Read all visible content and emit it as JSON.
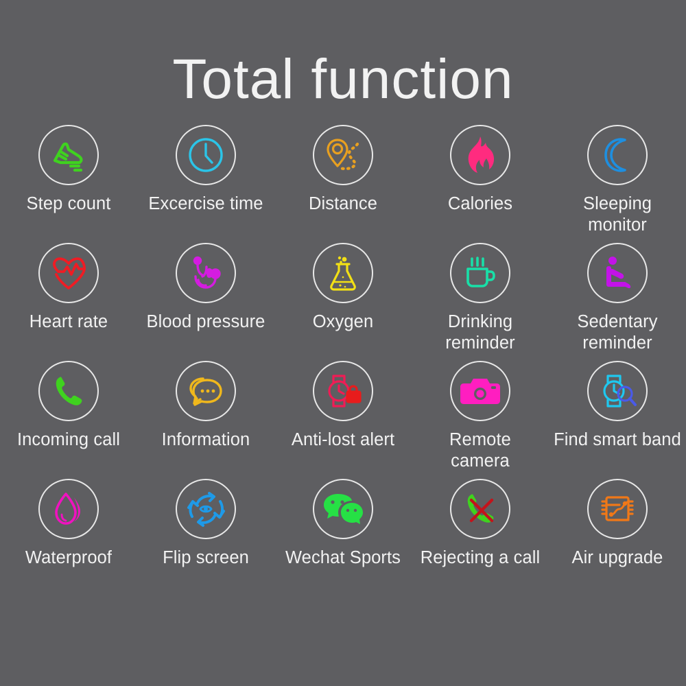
{
  "page": {
    "title": "Total function",
    "background_color": "#5e5e61",
    "text_color": "#f2f2f2",
    "circle_border_color": "#e8e8e8"
  },
  "features": [
    [
      {
        "label": "Step count",
        "icon": "running-shoe-icon",
        "color": "#3fd21f"
      },
      {
        "label": "Excercise time",
        "icon": "clock-icon",
        "color": "#2bc4e8"
      },
      {
        "label": "Distance",
        "icon": "map-pin-route-icon",
        "color": "#e8a020"
      },
      {
        "label": "Calories",
        "icon": "flame-icon",
        "color": "#ff2b7f"
      },
      {
        "label": "Sleeping monitor",
        "icon": "crescent-moon-icon",
        "color": "#1e8fe0"
      }
    ],
    [
      {
        "label": "Heart rate",
        "icon": "heart-pulse-icon",
        "color": "#ef1c24"
      },
      {
        "label": "Blood pressure",
        "icon": "stethoscope-icon",
        "color": "#d41ce0"
      },
      {
        "label": "Oxygen",
        "icon": "flask-icon",
        "color": "#f2e015"
      },
      {
        "label": "Drinking reminder",
        "icon": "coffee-cup-icon",
        "color": "#18e0a8"
      },
      {
        "label": "Sedentary reminder",
        "icon": "sitting-person-icon",
        "color": "#c313e8"
      }
    ],
    [
      {
        "label": "Incoming call",
        "icon": "phone-handset-icon",
        "color": "#3fd21f"
      },
      {
        "label": "Information",
        "icon": "chat-bubbles-icon",
        "color": "#f0b81c"
      },
      {
        "label": "Anti-lost alert",
        "icon": "watch-lock-icon",
        "color": "#f01c55"
      },
      {
        "label": "Remote camera",
        "icon": "camera-icon",
        "color": "#ff1ec0"
      },
      {
        "label": "Find smart band",
        "icon": "watch-search-icon",
        "color": "#1ec8f0"
      }
    ],
    [
      {
        "label": "Waterproof",
        "icon": "water-drop-icon",
        "color": "#f012c0"
      },
      {
        "label": "Flip screen",
        "icon": "flip-rotate-eye-icon",
        "color": "#1e9ae8"
      },
      {
        "label": "Wechat Sports",
        "icon": "wechat-bubbles-icon",
        "color": "#26e045"
      },
      {
        "label": "Rejecting a call",
        "icon": "phone-reject-icon",
        "color": "#3fd21f"
      },
      {
        "label": "Air upgrade",
        "icon": "chip-upgrade-icon",
        "color": "#f07818"
      }
    ]
  ]
}
